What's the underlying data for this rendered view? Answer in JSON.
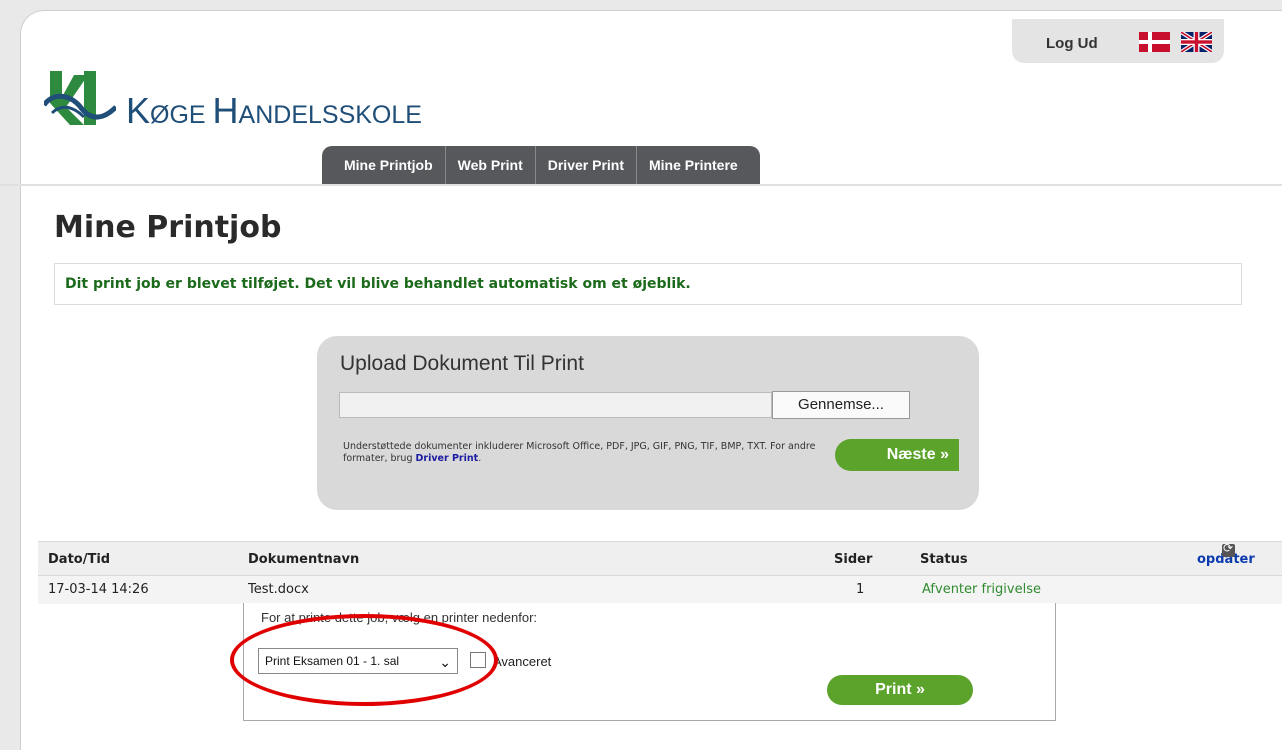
{
  "header": {
    "logout_label": "Log Ud",
    "brand_part1": "K",
    "brand_part2": "ØGE ",
    "brand_part3": "H",
    "brand_part4": "ANDELSSKOLE"
  },
  "nav": {
    "items": [
      {
        "label": "Mine Printjob"
      },
      {
        "label": "Web Print"
      },
      {
        "label": "Driver Print"
      },
      {
        "label": "Mine Printere"
      }
    ]
  },
  "main": {
    "title": "Mine Printjob",
    "notice": "Dit print job er blevet tilføjet. Det vil blive behandlet automatisk om et øjeblik."
  },
  "upload": {
    "title": "Upload Dokument Til Print",
    "browse_label": "Gennemse...",
    "supported_text": "Understøttede dokumenter inkluderer Microsoft Office, PDF, JPG, GIF, PNG, TIF, BMP, TXT. For andre formater, brug",
    "driver_link": "Driver Print",
    "supported_suffix": ".",
    "next_label": "Næste »"
  },
  "table": {
    "headers": [
      "Dato/Tid",
      "Dokumentnavn",
      "Sider",
      "Status"
    ],
    "refresh_label": "opdater",
    "row": {
      "date": "17-03-14 14:26",
      "document": "Test.docx",
      "pages": "1",
      "status": "Afventer frigivelse"
    }
  },
  "print_panel": {
    "instruction": "For at printe dette job, vælg en printer nedenfor:",
    "printer_selected": "Print Eksamen 01 - 1. sal",
    "advanced_label": "Avanceret",
    "print_label": "Print »"
  },
  "colors": {
    "accent_green": "#5ca32c",
    "nav_bg": "#56585b",
    "annotation_red": "#e00000",
    "status_green": "#2f8b2f"
  }
}
